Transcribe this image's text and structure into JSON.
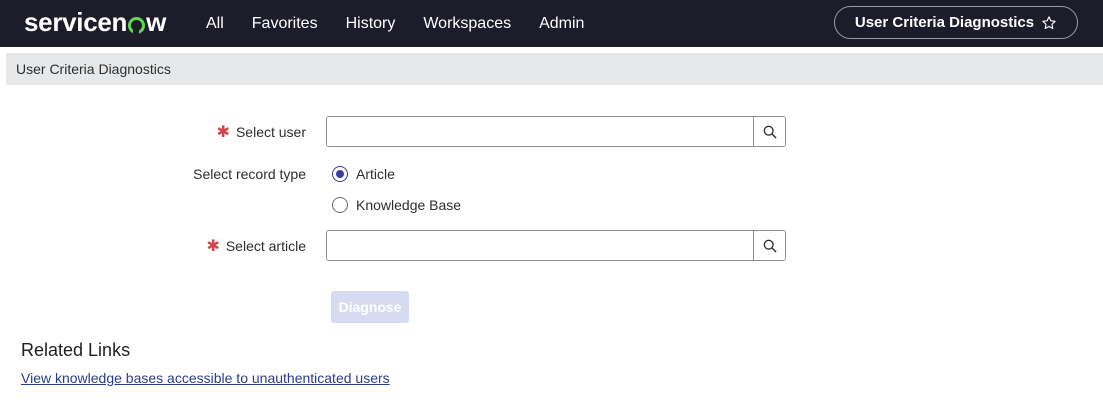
{
  "app": {
    "logo_text_pre": "servicen",
    "logo_text_post": "w",
    "nav_items": [
      "All",
      "Favorites",
      "History",
      "Workspaces",
      "Admin"
    ],
    "title_pill": "User Criteria Diagnostics",
    "colors": {
      "topbar": "#1c1c2b",
      "logo_accent": "#62d84e",
      "required": "#d0454c",
      "link": "#293e8a"
    }
  },
  "page": {
    "header_title": "User Criteria Diagnostics"
  },
  "form": {
    "required_marker": "✱",
    "select_user": {
      "label": "Select user",
      "value": ""
    },
    "record_type": {
      "label": "Select record type",
      "options": [
        "Article",
        "Knowledge Base"
      ],
      "selected": "Article"
    },
    "select_article": {
      "label": "Select article",
      "value": ""
    },
    "diagnose_label": "Diagnose"
  },
  "related": {
    "title": "Related Links",
    "link": "View knowledge bases accessible to unauthenticated users"
  },
  "icons": {
    "lookup": "search-icon",
    "favorite": "star-outline-icon"
  }
}
